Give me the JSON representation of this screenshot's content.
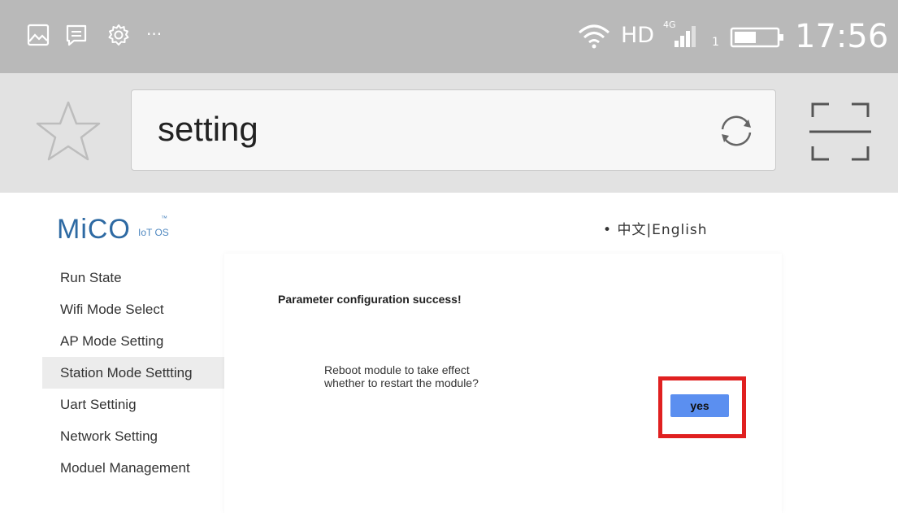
{
  "status_bar": {
    "left_icons": [
      "image-icon",
      "message-icon",
      "settings-icon"
    ],
    "more": "···",
    "network": "HD",
    "signal_label": "4G",
    "sim_number": "1",
    "time": "17:56"
  },
  "browser": {
    "address_text": "setting"
  },
  "page": {
    "logo": {
      "main": "MiCO",
      "sub": "IoT OS",
      "tm": "™"
    },
    "language": {
      "bullet": "•",
      "chinese": "中文",
      "separator": "|",
      "english": "English"
    },
    "nav": [
      {
        "label": "Run State"
      },
      {
        "label": "Wifi Mode Select"
      },
      {
        "label": "AP Mode Setting"
      },
      {
        "label": "Station Mode Settting",
        "active": true
      },
      {
        "label": "Uart Settinig"
      },
      {
        "label": "Network Setting"
      },
      {
        "label": "Moduel Management"
      }
    ],
    "content": {
      "success": "Parameter configuration success!",
      "reboot_line1": "Reboot module to take effect",
      "reboot_line2": "whether to restart the module?",
      "yes_label": "yes"
    }
  },
  "colors": {
    "status_bar_bg": "#b9b9b9",
    "address_bar_bg": "#e2e2e2",
    "logo_blue": "#2e6aa3",
    "button_blue": "#5b8ff0",
    "highlight_red": "#e02020"
  }
}
